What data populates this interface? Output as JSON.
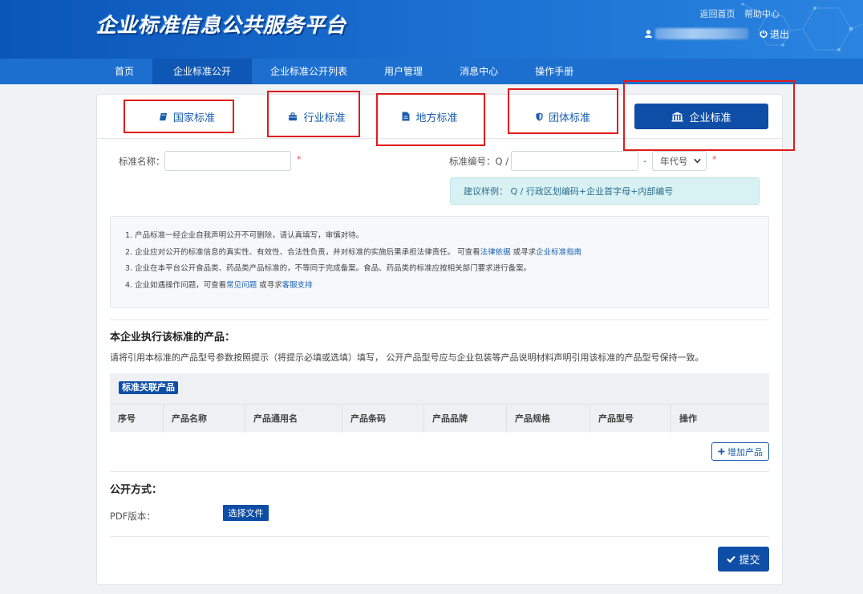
{
  "header": {
    "site_title": "企业标准信息公共服务平台",
    "links": [
      "返回首页",
      "帮助中心"
    ],
    "logout_label": "退出"
  },
  "nav": {
    "items": [
      {
        "label": "首页"
      },
      {
        "label": "企业标准公开",
        "active": true
      },
      {
        "label": "企业标准公开列表"
      },
      {
        "label": "用户管理"
      },
      {
        "label": "消息中心"
      },
      {
        "label": "操作手册"
      }
    ]
  },
  "tabs": {
    "items": [
      {
        "label": "国家标准",
        "icon": "book-icon"
      },
      {
        "label": "行业标准",
        "icon": "briefcase-icon"
      },
      {
        "label": "地方标准",
        "icon": "document-icon"
      },
      {
        "label": "团体标准",
        "icon": "shield-icon"
      },
      {
        "label": "企业标准",
        "icon": "bank-icon",
        "active": true
      }
    ]
  },
  "form": {
    "name_label": "标准名称：",
    "name_value": "",
    "code_label": "标准编号：Q /",
    "code_value": "",
    "dash": "-",
    "year_select": "年代号",
    "required_mark": "*",
    "hint": "建议样例：  Q / 行政区划编码+企业首字母+内部编号"
  },
  "notice": {
    "line1": "1. 产品标准一经企业自我声明公开不可删除，请认真填写，审慎对待。",
    "line2_pre": "2. 企业应对公开的标准信息的真实性、有效性、合法性负责，并对标准的实施后果承担法律责任。 可查看",
    "line2_link1": "法律依据",
    "line2_mid": " 或寻求",
    "line2_link2": "企业标准指南",
    "line3": "3. 企业在本平台公开食品类、药品类产品标准的，不等同于完成备案。食品、药品类的标准应按相关部门要求进行备案。",
    "line4_pre": "4. 企业如遇操作问题，可查看",
    "line4_link1": "常见问题",
    "line4_mid": " 或寻求",
    "line4_link2": "客服支持"
  },
  "products": {
    "title": "本企业执行该标准的产品：",
    "desc": "请将引用本标准的产品型号参数按照提示（将提示必填或选填）填写， 公开产品型号应与企业包装等产品说明材料声明引用该标准的产品型号保持一致。",
    "badge": "标准关联产品",
    "columns": [
      "序号",
      "产品名称",
      "产品通用名",
      "产品条码",
      "产品品牌",
      "产品规格",
      "产品型号",
      "操作"
    ],
    "add_label": "增加产品"
  },
  "publish": {
    "title": "公开方式：",
    "pdf_label": "PDF版本：",
    "file_button": "选择文件"
  },
  "submit_label": "提交",
  "colors": {
    "header_bg": "#0a55b8",
    "nav_bg": "#1d6fcf",
    "primary": "#0e4ea6",
    "highlight": "#e21b1b",
    "hint_bg": "#d8f1f3"
  }
}
